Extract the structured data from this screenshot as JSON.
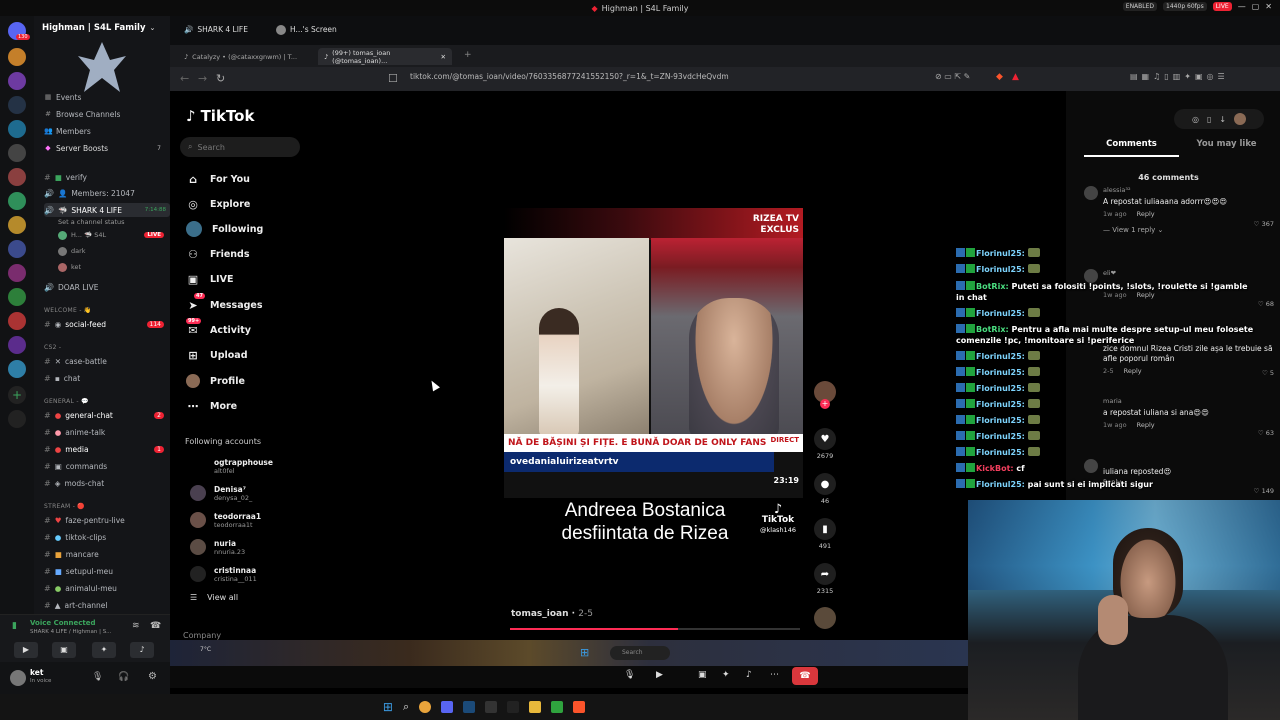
{
  "window": {
    "title": "Highman | S4L Family"
  },
  "system": {
    "enabled_label": "ENABLED",
    "stream_quality": "1440p 60fps",
    "live_label": "LIVE"
  },
  "discord": {
    "server_name": "Highman | S4L Family",
    "top_items": [
      {
        "label": "Events",
        "icon": "calendar-icon"
      },
      {
        "label": "Browse Channels",
        "icon": "browse-icon"
      },
      {
        "label": "Members",
        "icon": "members-icon"
      },
      {
        "label": "Server Boosts",
        "icon": "boost-icon",
        "badge": "7"
      }
    ],
    "channels": {
      "verify": "verify",
      "members_count": "Members: 21047",
      "shark_voice": "SHARK 4 LIFE",
      "shark_time": "7:14:88",
      "shark_sub": "Set a channel status",
      "voice_user_1": "H... 🦈 S4L",
      "voice_user_2": "dark",
      "voice_user_3": "ket",
      "doar_live": "DOAR LIVE",
      "cat_welcome": "WELCOME - 👋",
      "social_feed": "social-feed",
      "social_badge": "114",
      "cat_cs2": "CS2 -",
      "case_battle": "case-battle",
      "chat": "chat",
      "cat_general": "GENERAL - 💬",
      "general_chat": "general-chat",
      "general_badge": "2",
      "anime_talk": "anime-talk",
      "media": "media",
      "media_badge": "1",
      "commands": "commands",
      "mods_chat": "mods-chat",
      "cat_stream": "STREAM - 🔴",
      "faze": "faze-pentru-live",
      "tiktok_clips": "tiktok-clips",
      "mancare": "mancare",
      "setupul": "setupul-meu",
      "animalul": "animalul-meu",
      "art": "art-channel"
    },
    "voice": {
      "status": "Voice Connected",
      "channel": "SHARK 4 LIFE / Highman | S..."
    },
    "user": {
      "name": "ket",
      "status": "In voice"
    },
    "live_badge": "LIVE"
  },
  "browser": {
    "top_tabs": [
      {
        "label": "SHARK 4 LIFE"
      },
      {
        "label": "H...'s Screen"
      }
    ],
    "tabs": [
      {
        "label": "Catalyzy • (@cataxxgnwm) | T..."
      },
      {
        "label": "(99+) tomas_ioan (@tomas_ioan)..."
      }
    ],
    "url": "tiktok.com/@tomas_ioan/video/7603356877241552150?_r=1&_t=ZN-93vdcHeQvdm"
  },
  "tiktok": {
    "brand": "TikTok",
    "search_placeholder": "Search",
    "nav": [
      {
        "label": "For You",
        "icon": "home-icon"
      },
      {
        "label": "Explore",
        "icon": "compass-icon"
      },
      {
        "label": "Following",
        "icon": "following-icon"
      },
      {
        "label": "Friends",
        "icon": "friends-icon"
      },
      {
        "label": "LIVE",
        "icon": "live-icon"
      },
      {
        "label": "Messages",
        "icon": "messages-icon",
        "badge": "47"
      },
      {
        "label": "Activity",
        "icon": "activity-icon",
        "badge": "99+"
      },
      {
        "label": "Upload",
        "icon": "upload-icon"
      },
      {
        "label": "Profile",
        "icon": "profile-icon"
      },
      {
        "label": "More",
        "icon": "more-icon"
      }
    ],
    "following_header": "Following accounts",
    "following": [
      {
        "name": "ogtrapphouse",
        "handle": "alt0fel"
      },
      {
        "name": "Denisa⁷",
        "handle": "denysa_02_"
      },
      {
        "name": "teodorraa1",
        "handle": "teodorraa1t"
      },
      {
        "name": "nuria",
        "handle": "nnuria.23"
      },
      {
        "name": "cristinnaa",
        "handle": "cristina__011"
      }
    ],
    "view_all": "View all",
    "company": "Company",
    "video": {
      "caption": "Andreea Bostanica desfiintata de Rizea",
      "tag_top": "RIZEA TV",
      "tag_exclusive": "EXCLUS",
      "lower_third": "NĂ DE BĂȘINI ȘI FIȚE. E BUNĂ DOAR DE ONLY FANS",
      "handle_bar": "ovedanialuirizeatvrtv",
      "direct": "DIRECT",
      "clock": "23:19",
      "watermark": "TikTok",
      "watermark_handle": "@klash146",
      "author": "tomas_ioan",
      "date": "2-5",
      "progress": 0.58
    },
    "actions": [
      {
        "name": "like",
        "count": "2679"
      },
      {
        "name": "comment",
        "count": "46"
      },
      {
        "name": "save",
        "count": "491"
      },
      {
        "name": "share",
        "count": "2315"
      }
    ],
    "panel_tabs": [
      "Comments",
      "You may like"
    ],
    "comments_count": "46 comments",
    "comments": [
      {
        "user": "alessia³²",
        "text": "A repostat iuliaaana adorrr😍😍😍",
        "time": "1w ago",
        "reply": "Reply",
        "likes": "367",
        "view_replies": "View 1 reply"
      },
      {
        "user": "eli❤",
        "text": "",
        "time": "1w ago",
        "reply": "Reply",
        "likes": "68"
      },
      {
        "user": "",
        "text": "zice domnul Rizea Cristi zile așa le trebuie să afle poporul român",
        "time": "2-5",
        "reply": "Reply",
        "likes": "5"
      },
      {
        "user": "maria",
        "text": "a repostat iuliana si ana😍😍",
        "time": "1w ago",
        "reply": "Reply",
        "likes": "63"
      },
      {
        "user": "",
        "text": "iuliana reposted😍",
        "time": "",
        "reply": "Reply",
        "likes": "149"
      }
    ]
  },
  "chat_overlay": [
    {
      "user": "Florinul25:",
      "msg": "",
      "type": "user"
    },
    {
      "user": "Florinul25:",
      "msg": "",
      "type": "user"
    },
    {
      "user": "BotRix:",
      "msg": "Puteti sa folositi !points, !slots, !roulette si !gamble in chat",
      "type": "bot"
    },
    {
      "user": "Florinul25:",
      "msg": "",
      "type": "user"
    },
    {
      "user": "BotRix:",
      "msg": "Pentru a afla mai multe despre setup-ul meu folosete comenzile !pc, !monitoare si !periferice",
      "type": "bot"
    },
    {
      "user": "Florinul25:",
      "msg": "",
      "type": "user"
    },
    {
      "user": "Florinul25:",
      "msg": "",
      "type": "user"
    },
    {
      "user": "Florinul25:",
      "msg": "",
      "type": "user"
    },
    {
      "user": "Florinul25:",
      "msg": "",
      "type": "user"
    },
    {
      "user": "Florinul25:",
      "msg": "",
      "type": "user"
    },
    {
      "user": "Florinul25:",
      "msg": "",
      "type": "user"
    },
    {
      "user": "Florinul25:",
      "msg": "",
      "type": "user"
    },
    {
      "user": "KickBot:",
      "msg": "cf",
      "type": "kick"
    },
    {
      "user": "Florinul25:",
      "msg": "pai sunt si ei implicati sigur",
      "type": "user"
    }
  ],
  "taskbar": {
    "search_placeholder": "Search",
    "weather": "7°C"
  },
  "colors": {
    "tiktok_accent": "#fe2c55",
    "discord_bg": "#141518",
    "live_red": "#e23"
  }
}
